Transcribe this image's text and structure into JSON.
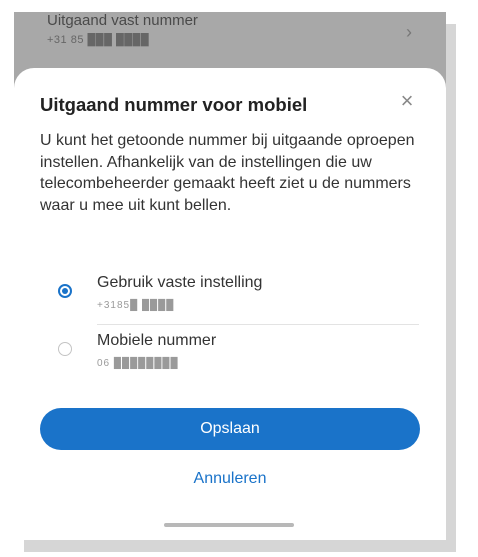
{
  "background_item": {
    "title": "Uitgaand vast nummer",
    "subtitle": "+31 85 ███ ████",
    "chevron_icon": "chevron-right-icon"
  },
  "dialog": {
    "title": "Uitgaand nummer voor mobiel",
    "close_icon": "close-icon",
    "close_glyph": "×",
    "description": "U kunt het getoonde nummer bij uitgaande oproepen instellen. Afhankelijk van de instellingen die uw telecombeheerder gemaakt heeft ziet u de nummers waar u mee uit kunt bellen.",
    "options": [
      {
        "label": "Gebruik vaste instelling",
        "sub": "+3185█ ████",
        "selected": true
      },
      {
        "label": "Mobiele nummer",
        "sub": "06 ████████",
        "selected": false
      }
    ],
    "save_label": "Opslaan",
    "cancel_label": "Annuleren"
  },
  "colors": {
    "accent": "#1a73c9",
    "scrim": "#a8a8a8",
    "sheet": "#ffffff"
  }
}
